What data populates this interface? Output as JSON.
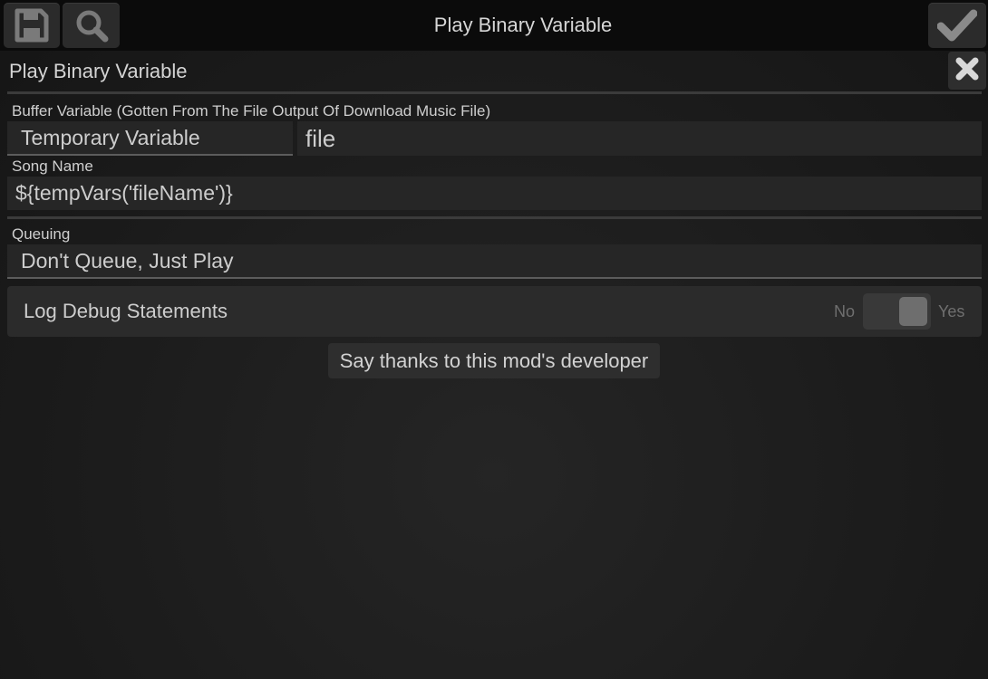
{
  "app": {
    "title": "Play Binary Variable"
  },
  "toolbar": {
    "save_icon": "save-floppy-icon",
    "search_icon": "search-icon",
    "confirm_icon": "checkmark-icon"
  },
  "section": {
    "header": "Play Binary Variable",
    "close_icon": "close-x-icon"
  },
  "buffer": {
    "label": "Buffer Variable (Gotten From The File Output Of Download Music File)",
    "type_value": "Temporary Variable",
    "name_value": "file"
  },
  "song": {
    "label": "Song Name",
    "value": "${tempVars('fileName')}"
  },
  "queuing": {
    "label": "Queuing",
    "value": "Don't Queue, Just Play"
  },
  "debug": {
    "label": "Log Debug Statements",
    "off_label": "No",
    "on_label": "Yes",
    "state": "on"
  },
  "thanks": {
    "label": "Say thanks to this mod's developer"
  },
  "colors": {
    "background": "#1d1d1d",
    "titlebar": "#0b0b0b",
    "field": "#262626",
    "text": "#cfcfcf"
  }
}
